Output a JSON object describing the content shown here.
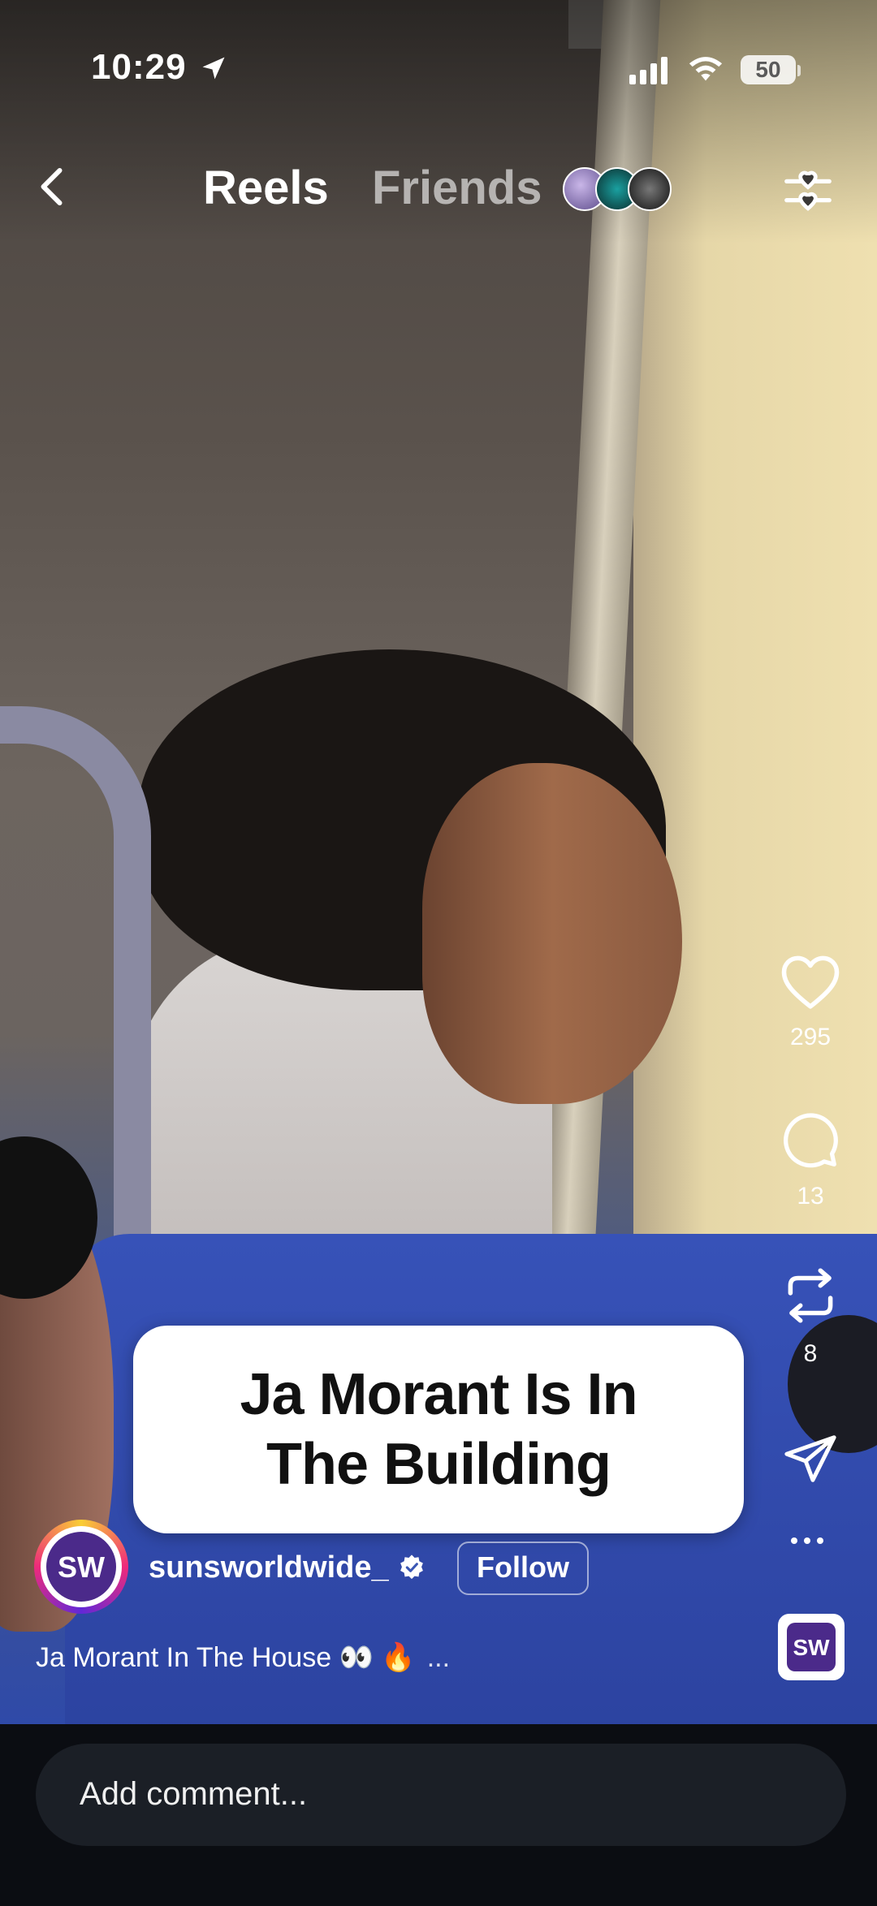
{
  "status_bar": {
    "time": "10:29",
    "battery": "50"
  },
  "header": {
    "back_icon": "chevron-left-icon",
    "tabs": [
      {
        "label": "Reels",
        "active": true
      },
      {
        "label": "Friends",
        "active": false
      }
    ],
    "filter_icon": "sliders-heart-icon"
  },
  "actions": {
    "like_count": "295",
    "comment_count": "13",
    "repost_count": "8"
  },
  "overlay": {
    "line1": "Ja Morant Is In",
    "line2": "The Building"
  },
  "author": {
    "username": "sunsworldwide_",
    "follow_label": "Follow",
    "logo_text": "SW"
  },
  "caption": {
    "text": "Ja Morant In The House 👀 🔥",
    "more": "..."
  },
  "comment_bar": {
    "placeholder": "Add comment..."
  },
  "colors": {
    "background": "#000000",
    "bottom_bar": "#0b0d12",
    "input": "#1b1f26",
    "logo_purple": "#4b2a8a"
  }
}
